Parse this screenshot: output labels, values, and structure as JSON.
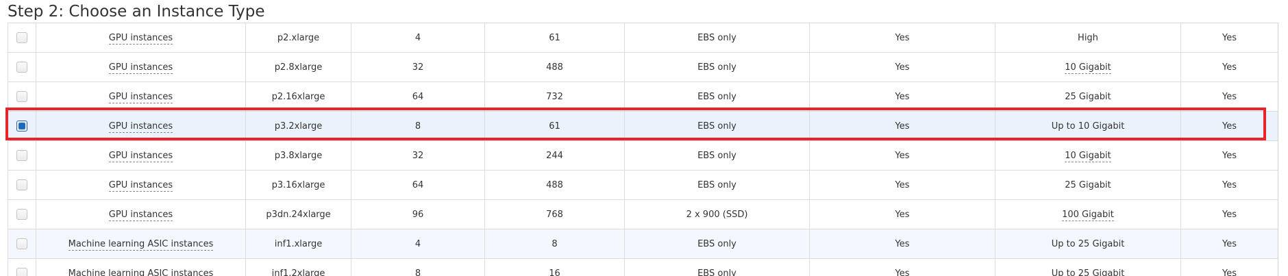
{
  "page": {
    "title": "Step 2: Choose an Instance Type"
  },
  "accent": {
    "highlight": "#e8232b",
    "checkbox": "#1f6dc0",
    "selected_row_bg": "#eaf3fb"
  },
  "rows": [
    {
      "family": "GPU instances",
      "type": "p2.xlarge",
      "vcpus": "4",
      "memory": "61",
      "storage": "EBS only",
      "ebs_optimized": "Yes",
      "network": "High",
      "network_dashed": false,
      "ipv6": "Yes",
      "checked": false
    },
    {
      "family": "GPU instances",
      "type": "p2.8xlarge",
      "vcpus": "32",
      "memory": "488",
      "storage": "EBS only",
      "ebs_optimized": "Yes",
      "network": "10 Gigabit",
      "network_dashed": true,
      "ipv6": "Yes",
      "checked": false
    },
    {
      "family": "GPU instances",
      "type": "p2.16xlarge",
      "vcpus": "64",
      "memory": "732",
      "storage": "EBS only",
      "ebs_optimized": "Yes",
      "network": "25 Gigabit",
      "network_dashed": false,
      "ipv6": "Yes",
      "checked": false
    },
    {
      "family": "GPU instances",
      "type": "p3.2xlarge",
      "vcpus": "8",
      "memory": "61",
      "storage": "EBS only",
      "ebs_optimized": "Yes",
      "network": "Up to 10 Gigabit",
      "network_dashed": false,
      "ipv6": "Yes",
      "checked": true
    },
    {
      "family": "GPU instances",
      "type": "p3.8xlarge",
      "vcpus": "32",
      "memory": "244",
      "storage": "EBS only",
      "ebs_optimized": "Yes",
      "network": "10 Gigabit",
      "network_dashed": true,
      "ipv6": "Yes",
      "checked": false
    },
    {
      "family": "GPU instances",
      "type": "p3.16xlarge",
      "vcpus": "64",
      "memory": "488",
      "storage": "EBS only",
      "ebs_optimized": "Yes",
      "network": "25 Gigabit",
      "network_dashed": false,
      "ipv6": "Yes",
      "checked": false
    },
    {
      "family": "GPU instances",
      "type": "p3dn.24xlarge",
      "vcpus": "96",
      "memory": "768",
      "storage": "2 x 900 (SSD)",
      "ebs_optimized": "Yes",
      "network": "100 Gigabit",
      "network_dashed": true,
      "ipv6": "Yes",
      "checked": false
    },
    {
      "family": "Machine learning ASIC instances",
      "type": "inf1.xlarge",
      "vcpus": "4",
      "memory": "8",
      "storage": "EBS only",
      "ebs_optimized": "Yes",
      "network": "Up to 25 Gigabit",
      "network_dashed": false,
      "ipv6": "Yes",
      "checked": false
    },
    {
      "family": "Machine learning ASIC instances",
      "type": "inf1.2xlarge",
      "vcpus": "8",
      "memory": "16",
      "storage": "EBS only",
      "ebs_optimized": "Yes",
      "network": "Up to 25 Gigabit",
      "network_dashed": false,
      "ipv6": "Yes",
      "checked": false
    }
  ]
}
